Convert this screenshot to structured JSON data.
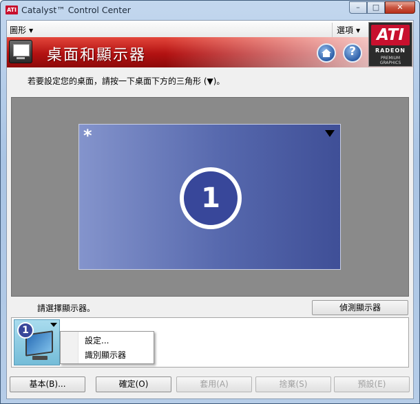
{
  "window": {
    "app_icon": "ATI",
    "title": "Catalyst™ Control Center",
    "minimize": "–",
    "maximize": "□",
    "close": "✕"
  },
  "menubar": {
    "graphics_label": "圖形",
    "options_label": "選項",
    "caret": "▼"
  },
  "header": {
    "title": "桌面和顯示器",
    "help_glyph": "?"
  },
  "logo": {
    "brand": "ATI",
    "line1": "RADEON",
    "line2": "PREMIUM",
    "line3": "GRAPHICS"
  },
  "instruction": "若要設定您的桌面，請按一下桌面下方的三角形 (▼)。",
  "desktop": {
    "primary_marker": "*",
    "display_number": "1"
  },
  "select_display_label": "請選擇顯示器。",
  "detect_button": "偵測顯示器",
  "thumbnail": {
    "display_number": "1"
  },
  "context_menu": {
    "items": [
      "設定...",
      "識別顯示器"
    ]
  },
  "buttons": {
    "basic": "基本(B)...",
    "ok": "確定(O)",
    "apply": "套用(A)",
    "discard": "捨棄(S)",
    "default": "預設(E)"
  },
  "colors": {
    "header_red": "#b31212",
    "desktop_tile": "#5668ad",
    "display_badge": "#38479a"
  }
}
